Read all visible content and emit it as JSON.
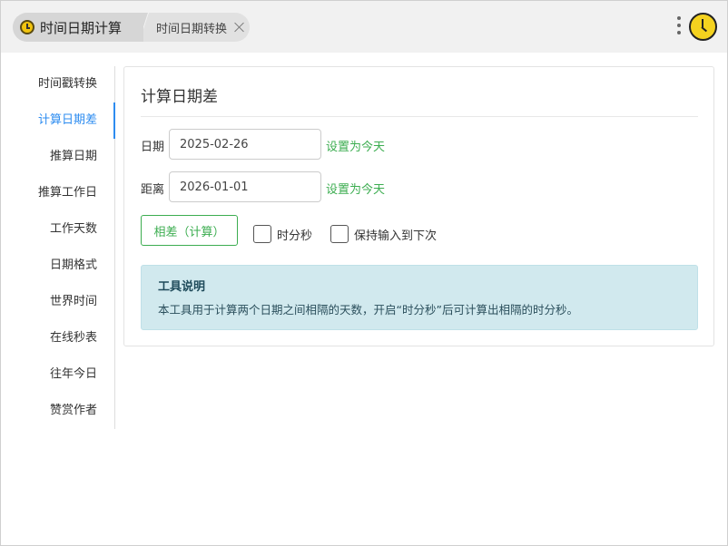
{
  "header": {
    "tabs": [
      {
        "label": "时间日期计算",
        "icon": "clock-icon"
      },
      {
        "label": "时间日期转换",
        "icon": "close-icon"
      }
    ],
    "menu_icon": "more-vertical-icon",
    "app_icon": "clock-icon"
  },
  "sidebar": {
    "active_index": 1,
    "items": [
      {
        "label": "时间戳转换"
      },
      {
        "label": "计算日期差"
      },
      {
        "label": "推算日期"
      },
      {
        "label": "推算工作日"
      },
      {
        "label": "工作天数"
      },
      {
        "label": "日期格式"
      },
      {
        "label": "世界时间"
      },
      {
        "label": "在线秒表"
      },
      {
        "label": "往年今日"
      },
      {
        "label": "赞赏作者"
      }
    ]
  },
  "main": {
    "title": "计算日期差",
    "date_label": "日期",
    "date_value": "2025-02-26",
    "distance_label": "距离",
    "distance_value": "2026-01-01",
    "set_today_label": "设置为今天",
    "calc_button_label": "相差（计算）",
    "checkbox_time_label": "时分秒",
    "checkbox_keep_label": "保持输入到下次",
    "info_title": "工具说明",
    "info_text": "本工具用于计算两个日期之间相隔的天数，开启“时分秒”后可计算出相隔的时分秒。"
  },
  "colors": {
    "accent_blue": "#2d8cf0",
    "accent_green": "#3cad50",
    "info_bg": "#d1e9ee"
  }
}
